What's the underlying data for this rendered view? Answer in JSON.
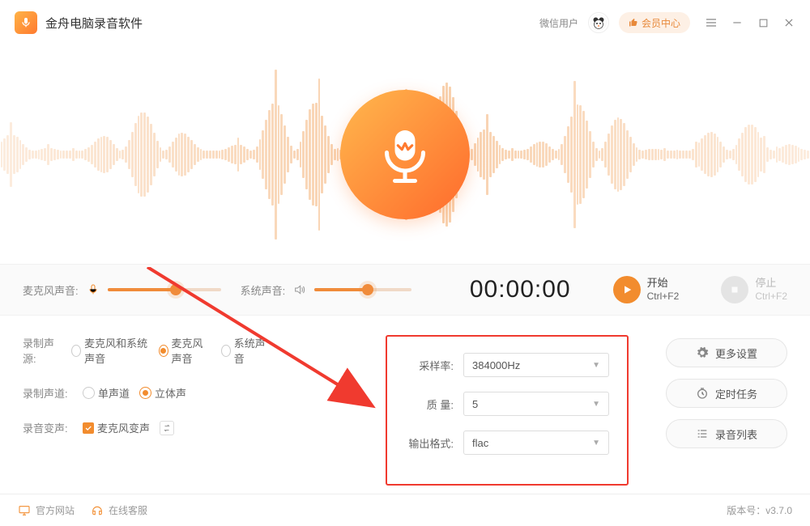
{
  "titlebar": {
    "app_name": "金舟电脑录音软件",
    "user_label": "微信用户",
    "vip_label": "会员中心"
  },
  "controls": {
    "mic_label": "麦克风声音:",
    "sys_label": "系统声音:",
    "mic_level_pct": 60,
    "sys_level_pct": 55,
    "timer": "00:00:00",
    "start_label": "开始",
    "start_shortcut": "Ctrl+F2",
    "stop_label": "停止",
    "stop_shortcut": "Ctrl+F2"
  },
  "options": {
    "source_label": "录制声源:",
    "source_opts": {
      "both": "麦克风和系统声音",
      "mic": "麦克风声音",
      "sys": "系统声音"
    },
    "source_selected": "mic",
    "channel_label": "录制声道:",
    "channel_opts": {
      "mono": "单声道",
      "stereo": "立体声"
    },
    "channel_selected": "stereo",
    "voice_label": "录音变声:",
    "voice_check_label": "麦克风变声"
  },
  "params": {
    "sample_label": "采样率:",
    "sample_value": "384000Hz",
    "quality_label": "质 量:",
    "quality_value": "5",
    "format_label": "输出格式:",
    "format_value": "flac"
  },
  "side": {
    "more": "更多设置",
    "schedule": "定时任务",
    "list": "录音列表"
  },
  "footer": {
    "site": "官方网站",
    "support": "在线客服",
    "version_label": "版本号：",
    "version": "v3.7.0"
  },
  "colors": {
    "accent": "#f28c2e",
    "annotation": "#f03a2f"
  }
}
